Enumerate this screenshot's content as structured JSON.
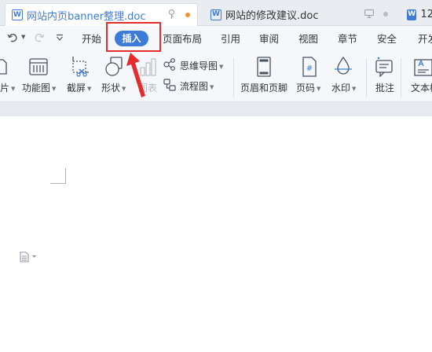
{
  "tabs": [
    {
      "title": "网站内页banner整理.doc",
      "active": true,
      "icon": "word-doc-icon"
    },
    {
      "title": "网站的修改建议.doc",
      "active": false,
      "icon": "word-doc-icon"
    },
    {
      "title": "12",
      "active": false,
      "icon": "word-doc-icon"
    }
  ],
  "menu": {
    "items": [
      "开始",
      "插入",
      "页面布局",
      "引用",
      "审阅",
      "视图",
      "章节",
      "安全",
      "开发"
    ],
    "active": "插入",
    "accent_color": "#3d7bd8",
    "highlight_color": "#e52b2b"
  },
  "ribbon": {
    "picture_label_partial": "片",
    "function_chart_label": "功能图",
    "screenshot_label": "截屏",
    "shape_label": "形状",
    "chart_label": "图表",
    "mindmap_label": "思维导图",
    "flowchart_label": "流程图",
    "header_footer_label": "页眉和页脚",
    "page_number_label": "页码",
    "watermark_label": "水印",
    "comment_label": "批注",
    "textbox_label": "文本框"
  },
  "page_number_icon_text": "#"
}
